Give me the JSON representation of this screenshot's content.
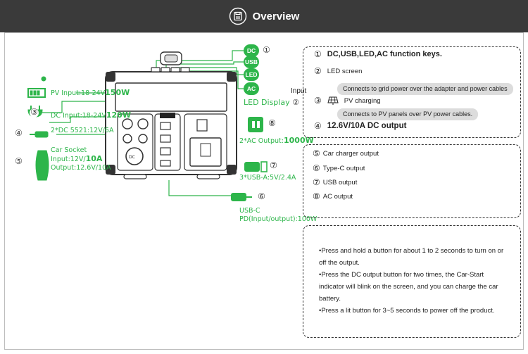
{
  "header": {
    "title": "Overview"
  },
  "colors": {
    "accent": "#2db54a",
    "header_bg": "#3a3a3a"
  },
  "diagram": {
    "keys": [
      "DC",
      "USB",
      "LED",
      "AC"
    ],
    "pv_input": {
      "text": "PV Input:18-24V",
      "bold": "150W"
    },
    "dc_input": {
      "text": "DC Input:18-24V",
      "bold": "120W"
    },
    "dc5521": "2*DC 5521:12V/6A",
    "car_socket": {
      "line1": "Car Socket",
      "line2": "Input:12V/",
      "line2_bold": "10A",
      "line3": "Output:12.6V/10A"
    },
    "led_display": "LED Display",
    "ac_output": {
      "text": "2*AC Output:",
      "bold": "1000W"
    },
    "usb_a": "3*USB-A:5V/2.4A",
    "usb_c": {
      "line1": "USB-C",
      "line2": "PD(Input/output):100W"
    },
    "nums": {
      "n1": "①",
      "n2": "②",
      "n3": "③",
      "n4": "④",
      "n5": "⑤",
      "n6": "⑥",
      "n7": "⑦",
      "n8": "⑧"
    }
  },
  "box1": {
    "item1": {
      "num": "①",
      "text": "DC,USB,LED,AC function keys."
    },
    "item2": {
      "num": "②",
      "text": "LED screen"
    },
    "input_label": "Input",
    "grid_note": "Connects to grid power over the adapter and power cables",
    "item3": {
      "num": "③",
      "text": "PV charging"
    },
    "pv_note": "Connects to PV panels over PV power cables.",
    "item4": {
      "num": "④",
      "text": "12.6V/10A DC output"
    }
  },
  "box2": {
    "items": [
      {
        "num": "⑤",
        "text": "Car charger output"
      },
      {
        "num": "⑥",
        "text": "Type-C output"
      },
      {
        "num": "⑦",
        "text": "USB output"
      },
      {
        "num": "⑧",
        "text": "AC output"
      }
    ]
  },
  "box3": {
    "bullets": [
      "•Press and hold a button for about 1 to 2 seconds to turn on or off the output.",
      "•Press the DC output button for two times, the Car-Start indicator will blink on the screen, and you can charge the car battery.",
      "•Press a lit button for 3~5 seconds to power off the product."
    ]
  }
}
